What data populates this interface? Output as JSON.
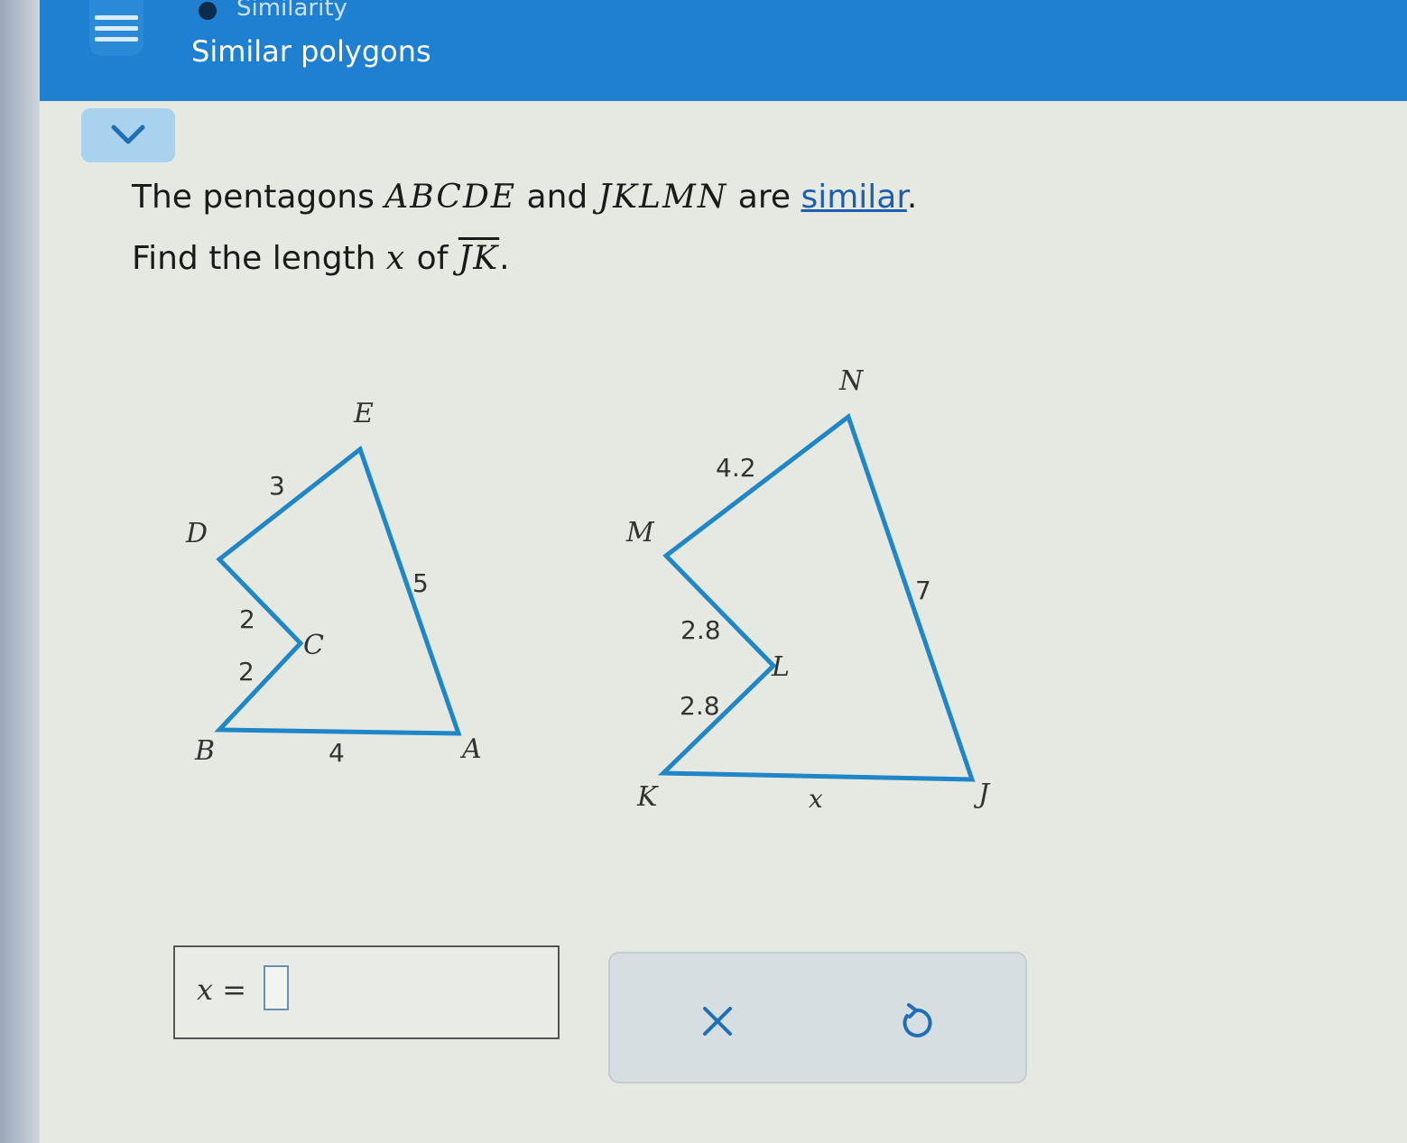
{
  "header": {
    "topic": "Similarity",
    "title": "Similar polygons"
  },
  "question": {
    "line1_pre": "The pentagons ",
    "poly1": "ABCDE",
    "and": " and ",
    "poly2": "JKLMN",
    "are": " are ",
    "link": "similar",
    "period": ".",
    "line2_pre": "Find the length ",
    "var": "x",
    "of": " of ",
    "segment": "JK",
    "line2_end": "."
  },
  "figure": {
    "pentagon1": {
      "vertices": [
        "A",
        "B",
        "C",
        "D",
        "E"
      ],
      "side_labels": {
        "DE": "3",
        "EA": "5",
        "DC": "2",
        "CB": "2",
        "BA": "4"
      }
    },
    "pentagon2": {
      "vertices": [
        "J",
        "K",
        "L",
        "M",
        "N"
      ],
      "side_labels": {
        "MN": "4.2",
        "NJ": "7",
        "ML": "2.8",
        "LK": "2.8",
        "KJ": "x"
      }
    },
    "color": "#1f86c8"
  },
  "answer": {
    "label": "x ="
  },
  "tools": {
    "clear": "×",
    "undo": "↺"
  }
}
